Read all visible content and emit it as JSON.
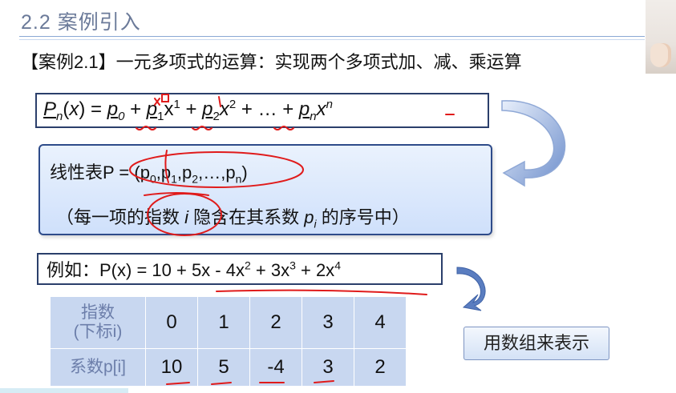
{
  "slide": {
    "title": "2.2 案例引入",
    "case_line": "【案例2.1】一元多项式的运算：实现两个多项式加、减、乘运算"
  },
  "formula": {
    "lhs_p": "P",
    "lhs_n": "n",
    "lhs_x": "(x) = ",
    "t0_p": "p",
    "t0_sub": "0",
    "t0_tail": " + ",
    "t1_p": "p",
    "t1_sub": "1",
    "t1_x": "x",
    "t1_sup": "1",
    "t1_tail": " + ",
    "t2_p": "p",
    "t2_sub": "2",
    "t2_x": "x",
    "t2_sup": "2",
    "t2_tail": " + … + ",
    "tn_p": "p",
    "tn_sub": "n",
    "tn_x": "x",
    "tn_sup": "n"
  },
  "linear_box": {
    "line1_prefix": "线性表P = (",
    "p": "p",
    "s0": "0",
    "s1": "1",
    "s2": "2",
    "sn": "n",
    "comma": ",",
    "ellipsis": "…,",
    "close": ")",
    "line2_a": "（每一项的指数 ",
    "line2_i": "i",
    "line2_b": " 隐含在其系数 ",
    "line2_p": "p",
    "line2_pi": "i",
    "line2_c": " 的序号中）"
  },
  "example": {
    "prefix": "例如：P(x) = 10 + 5x - 4x",
    "s2": "2",
    "mid1": " + 3x",
    "s3": "3",
    "mid2": " + 2x",
    "s4": "4"
  },
  "table": {
    "head_exp_line1": "指数",
    "head_exp_line2": "(下标i)",
    "head_coef": "系数p[i]",
    "indices": [
      "0",
      "1",
      "2",
      "3",
      "4"
    ],
    "coefficients": [
      "10",
      "5",
      "-4",
      "3",
      "2"
    ]
  },
  "cta_label": "用数组来表示",
  "colors": {
    "title": "#6b7a99",
    "box_border": "#2b3f6b",
    "blue_box_fill": "#cfe0fb",
    "table_fill": "#c8d7f0",
    "annotation_red": "#e01b1b",
    "arrow_blue": "#5a7dc0"
  }
}
